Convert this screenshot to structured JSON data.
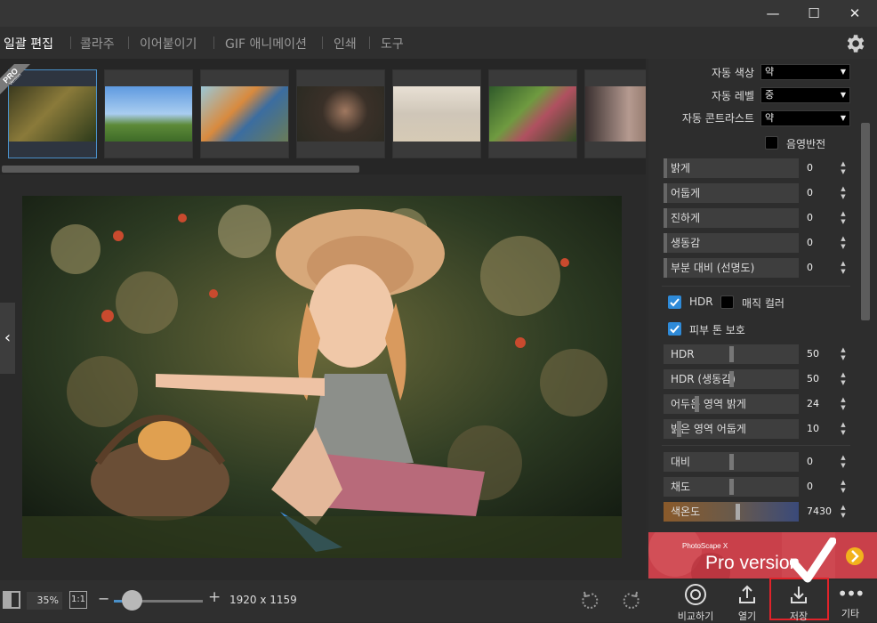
{
  "window": {
    "controls": [
      "—",
      "☐",
      "✕"
    ]
  },
  "menu": {
    "items": [
      {
        "label": "일괄 편집",
        "active": true
      },
      {
        "label": "콜라주",
        "active": false
      },
      {
        "label": "이어붙이기",
        "active": false
      },
      {
        "label": "GIF 애니메이션",
        "active": false
      },
      {
        "label": "인쇄",
        "active": false
      },
      {
        "label": "도구",
        "active": false
      }
    ],
    "settings_icon": "gear-icon"
  },
  "thumbnails": {
    "pro_ribbon": {
      "title": "PRO",
      "subtitle": "Version"
    },
    "count": 7,
    "selected_index": 0
  },
  "panel": {
    "auto_color": {
      "label": "자동 색상",
      "value": "약"
    },
    "auto_level": {
      "label": "자동 레벨",
      "value": "중"
    },
    "auto_contrast": {
      "label": "자동 콘트라스트",
      "value": "약"
    },
    "negative": {
      "label": "음영반전",
      "checked": false
    },
    "tone_sliders": [
      {
        "label": "밝게",
        "value": "0"
      },
      {
        "label": "어둡게",
        "value": "0"
      },
      {
        "label": "진하게",
        "value": "0"
      },
      {
        "label": "생동감",
        "value": "0"
      },
      {
        "label": "부분 대비 (선명도)",
        "value": "0"
      }
    ],
    "hdr": {
      "label": "HDR",
      "checked": true
    },
    "magic_color": {
      "label": "매직 컬러",
      "checked": false
    },
    "skin_protect": {
      "label": "피부 톤 보호",
      "checked": true
    },
    "hdr_sliders": [
      {
        "label": "HDR",
        "value": "50",
        "level": 0.5
      },
      {
        "label": "HDR (생동감)",
        "value": "50",
        "level": 0.5
      },
      {
        "label": "어두운 영역 밝게",
        "value": "24",
        "level": 0.24
      },
      {
        "label": "밝은 영역 어둡게",
        "value": "10",
        "level": 0.1
      }
    ],
    "color_sliders": [
      {
        "label": "대비",
        "value": "0",
        "level": 0.5
      },
      {
        "label": "채도",
        "value": "0",
        "level": 0.5
      },
      {
        "label": "색온도",
        "value": "7430",
        "level": 0.55
      }
    ]
  },
  "promo": {
    "brand": "PhotoScape X",
    "title": "Pro version",
    "arrow": "chevron-right-icon"
  },
  "bottom": {
    "zoom": "35%",
    "ratio": "1:1",
    "zoom_level": 0.2,
    "dimensions": "1920 x 1159",
    "actions": [
      {
        "label": "비교하기",
        "icon": "compare-icon"
      },
      {
        "label": "열기",
        "icon": "open-icon"
      },
      {
        "label": "저장",
        "icon": "save-icon"
      },
      {
        "label": "기타",
        "icon": "more-icon"
      }
    ]
  },
  "colors": {
    "accent": "#4a90c9",
    "highlight": "#e0232a",
    "checkbox_on": "#2e8ad8"
  }
}
